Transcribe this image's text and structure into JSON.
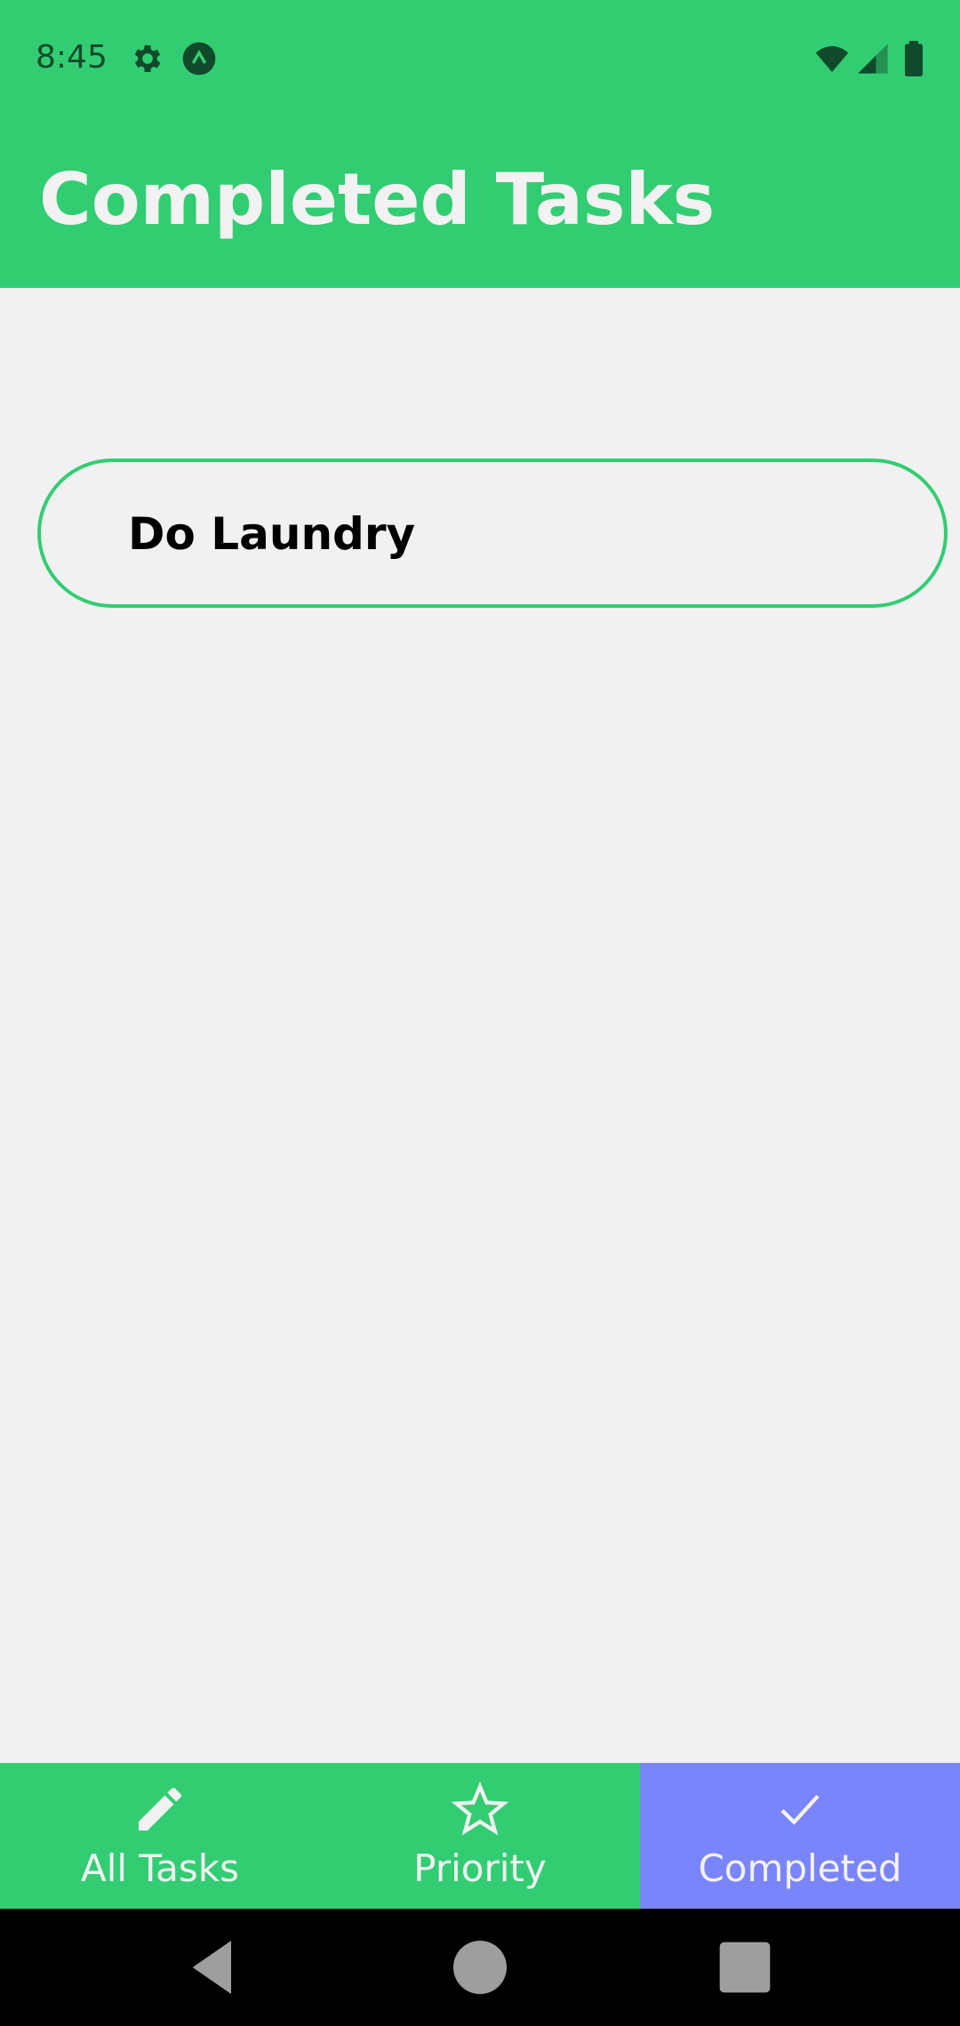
{
  "status_bar": {
    "time": "8:45",
    "icons": [
      "settings-icon",
      "app-notification-icon",
      "wifi-icon",
      "signal-icon",
      "battery-icon"
    ]
  },
  "header": {
    "title": "Completed Tasks",
    "background_color": "#32cd73"
  },
  "tasks": [
    {
      "label": "Do Laundry"
    }
  ],
  "tabs": [
    {
      "label": "All Tasks",
      "icon": "pencil-icon",
      "active": false
    },
    {
      "label": "Priority",
      "icon": "star-icon",
      "active": false
    },
    {
      "label": "Completed",
      "icon": "check-icon",
      "active": true
    }
  ],
  "colors": {
    "accent": "#32cd73",
    "active_tab": "#7b85fb",
    "background": "#f1f1f1"
  },
  "nav_bar": {
    "buttons": [
      "back-icon",
      "home-icon",
      "recents-icon"
    ]
  }
}
